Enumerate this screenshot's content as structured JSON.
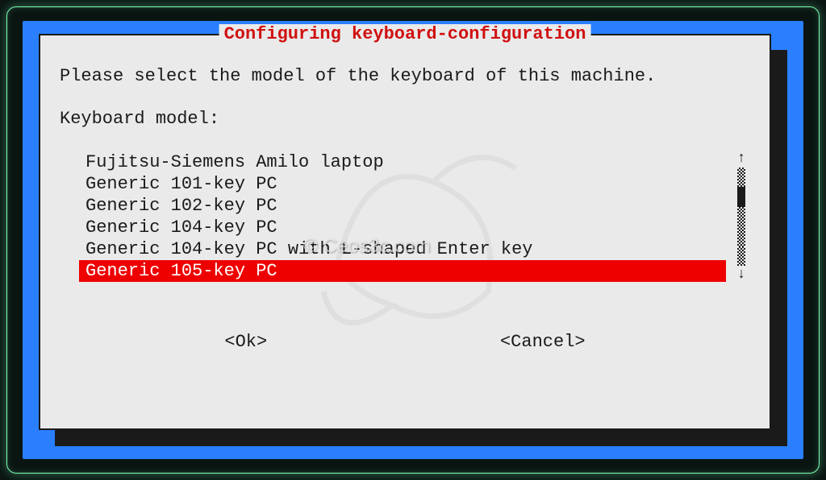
{
  "dialog": {
    "title": "Configuring keyboard-configuration",
    "instruction": "Please select the model of the keyboard of this machine.",
    "field_label": "Keyboard model:",
    "items": [
      {
        "label": "Fujitsu-Siemens Amilo laptop",
        "selected": false
      },
      {
        "label": "Generic 101-key PC",
        "selected": false
      },
      {
        "label": "Generic 102-key PC",
        "selected": false
      },
      {
        "label": "Generic 104-key PC",
        "selected": false
      },
      {
        "label": "Generic 104-key PC with L-shaped Enter key",
        "selected": false
      },
      {
        "label": "Generic 105-key PC",
        "selected": true
      }
    ],
    "buttons": {
      "ok": "<Ok>",
      "cancel": "<Cancel>"
    }
  },
  "watermark": "© Ceos3c.com",
  "colors": {
    "highlight": "#ee0000",
    "title": "#d01010",
    "frame": "#2a7fff",
    "glow": "#7dffb3"
  }
}
